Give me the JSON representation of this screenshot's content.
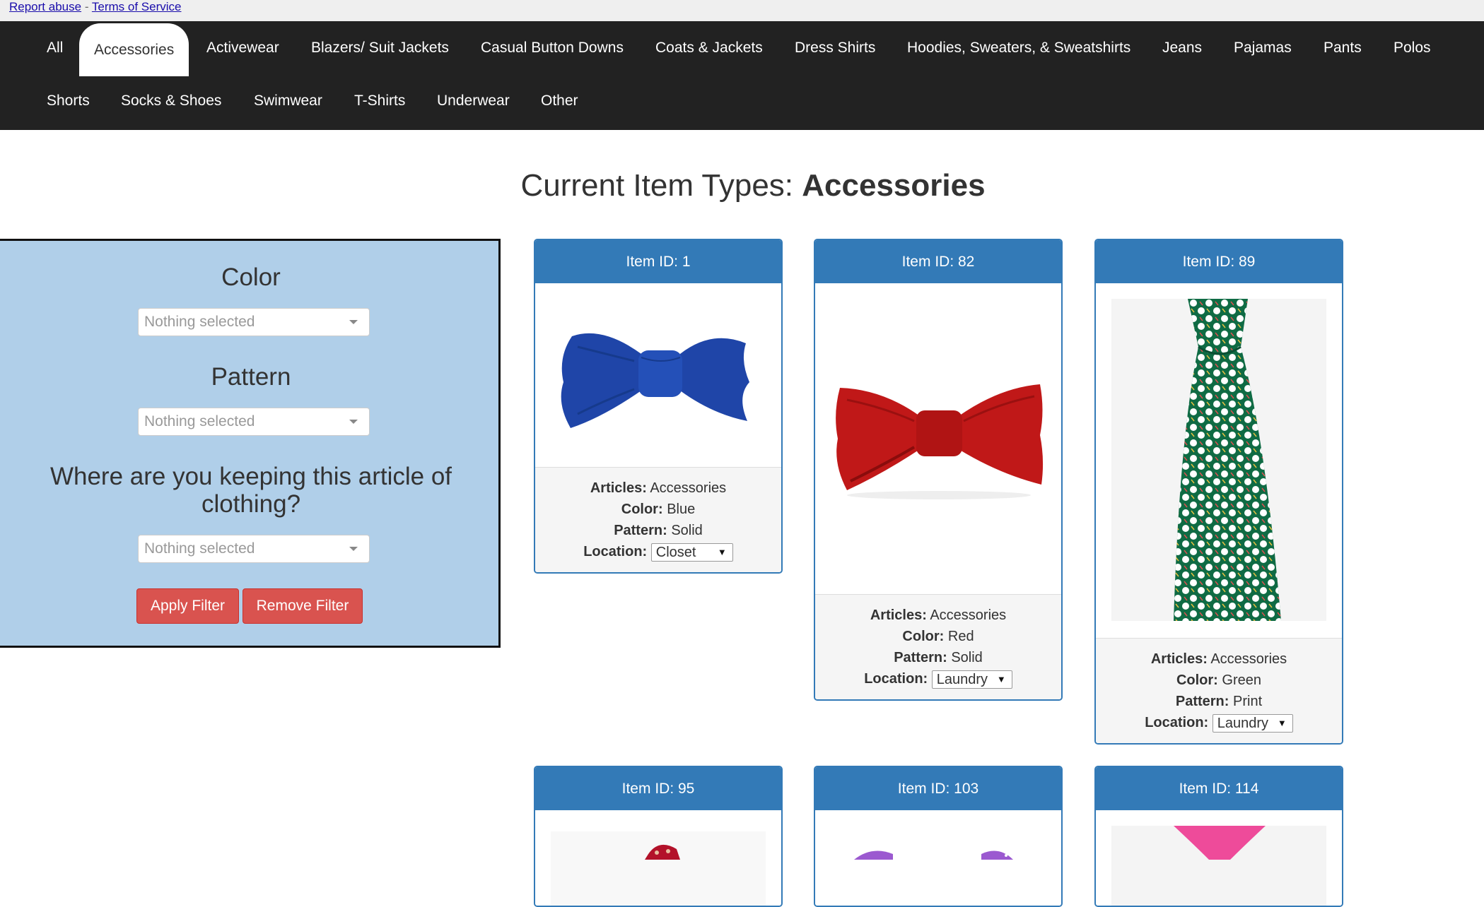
{
  "top_links": {
    "report_abuse": "Report abuse",
    "separator": "-",
    "terms": "Terms of Service"
  },
  "nav": {
    "row1": [
      "All",
      "Accessories",
      "Activewear",
      "Blazers/ Suit Jackets",
      "Casual Button Downs",
      "Coats & Jackets",
      "Dress Shirts",
      "Hoodies, Sweaters, & Sweatshirts",
      "Jeans",
      "Pajamas",
      "Pants",
      "Polos"
    ],
    "row2": [
      "Shorts",
      "Socks & Shoes",
      "Swimwear",
      "T-Shirts",
      "Underwear",
      "Other"
    ],
    "active": "Accessories"
  },
  "page_title": {
    "prefix": "Current Item Types: ",
    "category": "Accessories"
  },
  "filter": {
    "color_label": "Color",
    "color_placeholder": "Nothing selected",
    "pattern_label": "Pattern",
    "pattern_placeholder": "Nothing selected",
    "location_label": "Where are you keeping this article of clothing?",
    "location_placeholder": "Nothing selected",
    "apply_label": "Apply Filter",
    "remove_label": "Remove Filter"
  },
  "labels": {
    "articles": "Articles:",
    "color": "Color:",
    "pattern": "Pattern:",
    "location": "Location:"
  },
  "items": [
    {
      "title": "Item ID: 1",
      "articles": "Accessories",
      "color": "Blue",
      "pattern": "Solid",
      "location": "Closet",
      "image": "blue-bow-tie"
    },
    {
      "title": "Item ID: 82",
      "articles": "Accessories",
      "color": "Red",
      "pattern": "Solid",
      "location": "Laundry",
      "image": "red-bow-tie"
    },
    {
      "title": "Item ID: 89",
      "articles": "Accessories",
      "color": "Green",
      "pattern": "Print",
      "location": "Laundry",
      "image": "green-polka-dot-necktie"
    },
    {
      "title": "Item ID: 95",
      "image": "red-paisley-accessory"
    },
    {
      "title": "Item ID: 103",
      "image": "purple-bow-tie"
    },
    {
      "title": "Item ID: 114",
      "image": "pink-necktie"
    }
  ],
  "colors": {
    "navbar": "#222222",
    "panel": "#b0cfe9",
    "card_header": "#337ab7",
    "button": "#d9534f"
  }
}
